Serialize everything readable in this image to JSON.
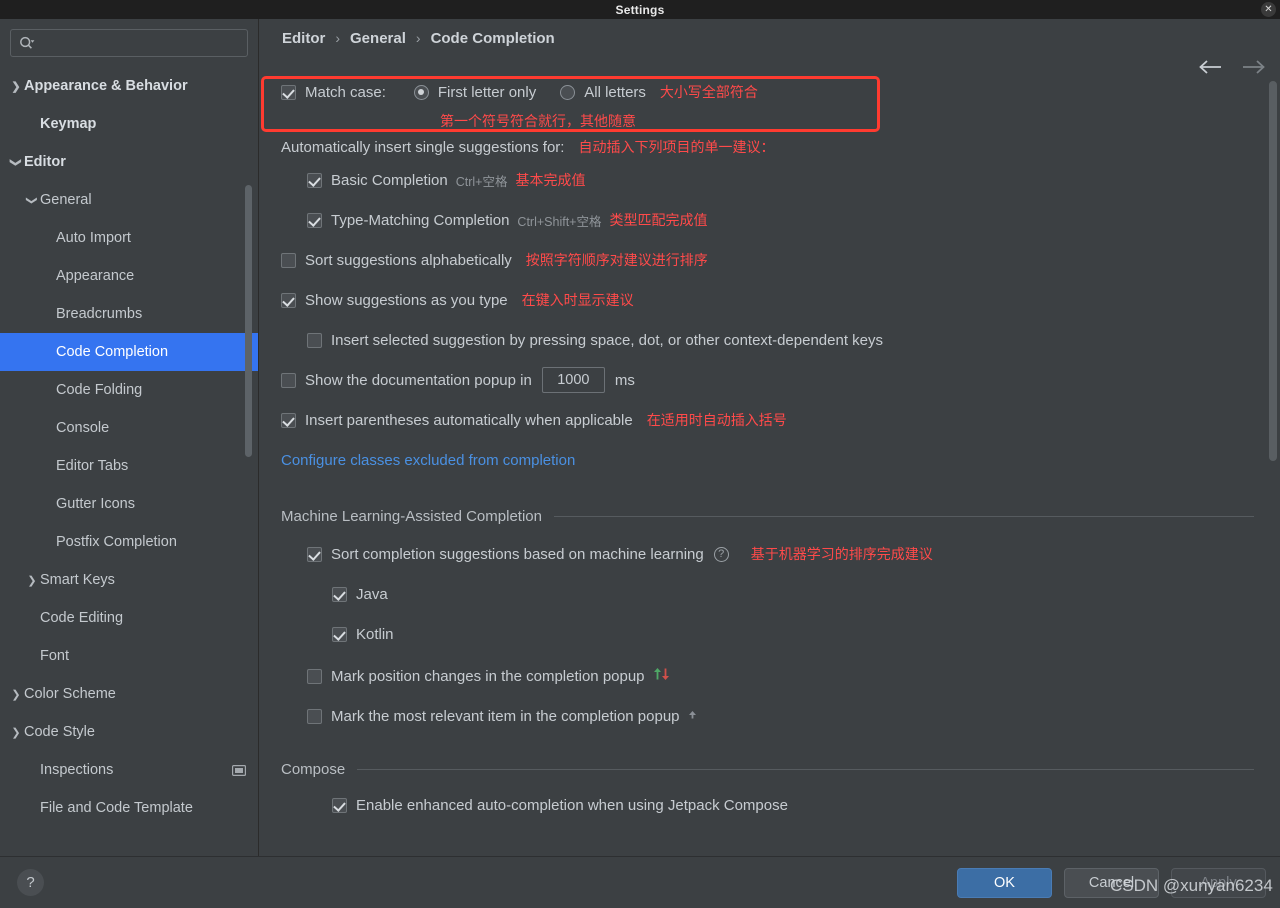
{
  "window": {
    "title": "Settings",
    "close_icon": "close-icon"
  },
  "sidebar": {
    "search": {
      "placeholder": "",
      "value": "",
      "icon": "search-icon"
    },
    "items": [
      {
        "label": "Appearance & Behavior",
        "level": 0,
        "twisty": "collapsed",
        "bold": true,
        "selected": false
      },
      {
        "label": "Keymap",
        "level": 1,
        "twisty": "none",
        "bold": true,
        "selected": false
      },
      {
        "label": "Editor",
        "level": 0,
        "twisty": "expanded",
        "bold": true,
        "selected": false
      },
      {
        "label": "General",
        "level": 1,
        "twisty": "expanded",
        "bold": false,
        "selected": false
      },
      {
        "label": "Auto Import",
        "level": 2,
        "twisty": "none",
        "bold": false,
        "selected": false
      },
      {
        "label": "Appearance",
        "level": 2,
        "twisty": "none",
        "bold": false,
        "selected": false
      },
      {
        "label": "Breadcrumbs",
        "level": 2,
        "twisty": "none",
        "bold": false,
        "selected": false
      },
      {
        "label": "Code Completion",
        "level": 2,
        "twisty": "none",
        "bold": false,
        "selected": true
      },
      {
        "label": "Code Folding",
        "level": 2,
        "twisty": "none",
        "bold": false,
        "selected": false
      },
      {
        "label": "Console",
        "level": 2,
        "twisty": "none",
        "bold": false,
        "selected": false
      },
      {
        "label": "Editor Tabs",
        "level": 2,
        "twisty": "none",
        "bold": false,
        "selected": false
      },
      {
        "label": "Gutter Icons",
        "level": 2,
        "twisty": "none",
        "bold": false,
        "selected": false
      },
      {
        "label": "Postfix Completion",
        "level": 2,
        "twisty": "none",
        "bold": false,
        "selected": false
      },
      {
        "label": "Smart Keys",
        "level": 1,
        "twisty": "collapsed",
        "bold": false,
        "selected": false
      },
      {
        "label": "Code Editing",
        "level": 1,
        "twisty": "none",
        "bold": false,
        "selected": false
      },
      {
        "label": "Font",
        "level": 1,
        "twisty": "none",
        "bold": false,
        "selected": false
      },
      {
        "label": "Color Scheme",
        "level": 0,
        "twisty": "collapsed",
        "bold": false,
        "selected": false
      },
      {
        "label": "Code Style",
        "level": 0,
        "twisty": "collapsed",
        "bold": false,
        "selected": false
      },
      {
        "label": "Inspections",
        "level": 1,
        "twisty": "none",
        "bold": false,
        "selected": false,
        "trail_icon": "panel-icon"
      },
      {
        "label": "File and Code Template",
        "level": 1,
        "twisty": "none",
        "bold": false,
        "selected": false
      }
    ]
  },
  "breadcrumb": {
    "parts": [
      "Editor",
      "General",
      "Code Completion"
    ],
    "separator": "›",
    "back_icon": "arrow-left-icon",
    "forward_icon": "arrow-right-icon"
  },
  "settings": {
    "match_case": {
      "label": "Match case:",
      "checked": true,
      "options": [
        {
          "label": "First letter only",
          "selected": true
        },
        {
          "label": "All letters",
          "selected": false
        }
      ],
      "zh_all_letters": "大小写全部符合",
      "zh_first_letter": "第一个符号符合就行，其他随意"
    },
    "auto_insert": {
      "label": "Automatically insert single suggestions for:",
      "zh": "自动插入下列项目的单一建议：",
      "items": [
        {
          "label": "Basic Completion",
          "shortcut": "Ctrl+空格",
          "zh": "基本完成值",
          "checked": true
        },
        {
          "label": "Type-Matching Completion",
          "shortcut": "Ctrl+Shift+空格",
          "zh": "类型匹配完成值",
          "checked": true
        }
      ]
    },
    "sort_alphabetically": {
      "label": "Sort suggestions alphabetically",
      "zh": "按照字符顺序对建议进行排序",
      "checked": false
    },
    "show_as_you_type": {
      "label": "Show suggestions as you type",
      "zh": "在键入时显示建议",
      "checked": true
    },
    "insert_selected": {
      "label": "Insert selected suggestion by pressing space, dot, or other context-dependent keys",
      "checked": false
    },
    "doc_popup": {
      "label_before": "Show the documentation popup in",
      "value": "1000",
      "label_after": "ms",
      "checked": false
    },
    "insert_parentheses": {
      "label": "Insert parentheses automatically when applicable",
      "zh": "在适用时自动插入括号",
      "checked": true
    },
    "excluded_link": "Configure classes excluded from completion",
    "ml_section": {
      "title": "Machine Learning-Assisted Completion",
      "sort_ml": {
        "label": "Sort completion suggestions based on machine learning",
        "zh": "基于机器学习的排序完成建议",
        "checked": true,
        "help_icon": "help-circle-icon"
      },
      "languages": [
        {
          "label": "Java",
          "checked": true
        },
        {
          "label": "Kotlin",
          "checked": true
        }
      ],
      "mark_position": {
        "label": "Mark position changes in the completion popup",
        "checked": false,
        "icons": [
          "arrow-up-green-icon",
          "arrow-down-red-icon"
        ]
      },
      "mark_relevant": {
        "label": "Mark the most relevant item in the completion popup",
        "checked": false,
        "icons": [
          "arrow-up-green-icon"
        ]
      }
    },
    "compose_section": {
      "title": "Compose",
      "enable_enhanced": {
        "label": "Enable enhanced auto-completion when using Jetpack Compose",
        "checked": true
      }
    }
  },
  "footer": {
    "help_label": "?",
    "ok": "OK",
    "cancel": "Cancel",
    "apply": "Apply"
  },
  "watermark": "CSDN @xunyan6234",
  "colors": {
    "accent_blue": "#3574f0",
    "annotation_red": "#ff3b30",
    "link_blue": "#4a90e2",
    "panel_bg": "#3c4043",
    "titlebar_bg": "#1f1f1f"
  }
}
